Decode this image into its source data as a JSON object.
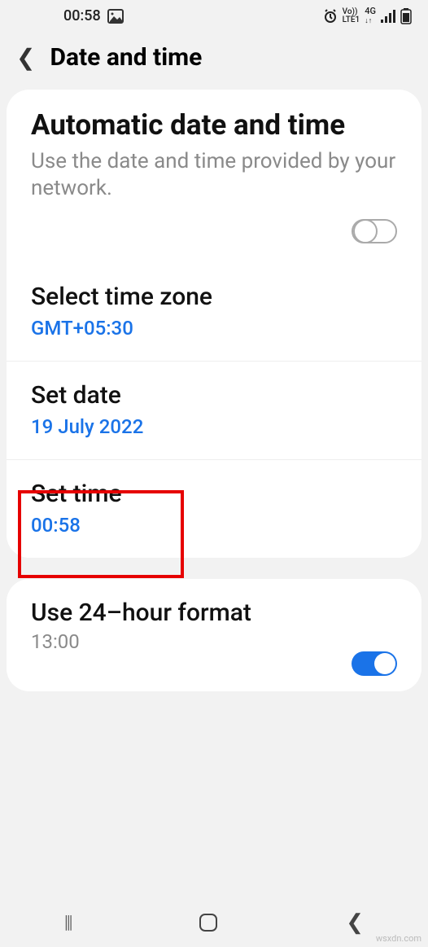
{
  "status": {
    "time": "00:58",
    "volte": "Vo))",
    "lte": "LTE1",
    "net": "4G"
  },
  "header": {
    "title": "Date and time"
  },
  "auto": {
    "title": "Automatic date and time",
    "sub": "Use the date and time provided by your network."
  },
  "timezone": {
    "label": "Select time zone",
    "value": "GMT+05:30"
  },
  "date": {
    "label": "Set date",
    "value": "19 July 2022"
  },
  "time": {
    "label": "Set time",
    "value": "00:58"
  },
  "format": {
    "label": "Use 24–hour format",
    "sub": "13:00"
  },
  "watermark": "wsxdn.com"
}
